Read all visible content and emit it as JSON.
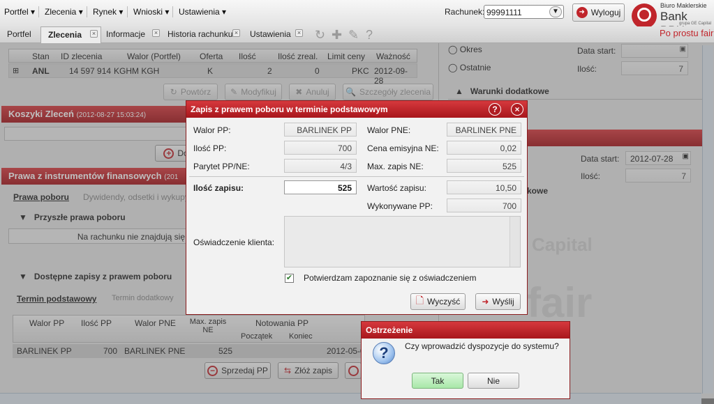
{
  "menu": {
    "items": [
      "Portfel",
      "Zlecenia",
      "Rynek",
      "Wnioski",
      "Ustawienia"
    ]
  },
  "account": {
    "label": "Rachunek:",
    "value": "99991111",
    "logout": "Wyloguj"
  },
  "brand": {
    "line1": "Biuro Maklerskie",
    "line2": "Bank BPH",
    "line3": "grupa GE Capital",
    "slogan": "Po prostu fair"
  },
  "tabs": [
    {
      "label": "Portfel"
    },
    {
      "label": "Zlecenia"
    },
    {
      "label": "Informacje"
    },
    {
      "label": "Historia rachunku"
    },
    {
      "label": "Ustawienia"
    }
  ],
  "orders": {
    "columns": [
      "Stan",
      "ID zlecenia",
      "Walor (Portfel)",
      "Oferta",
      "Ilość",
      "Ilość zreal.",
      "Limit ceny",
      "Ważność"
    ],
    "row": {
      "expand": "⊞",
      "stan": "ANL",
      "id": "14 597 914",
      "walor": "KGHM KGH",
      "oferta": "K",
      "ilosc": "2",
      "zreal": "0",
      "limit": "PKC",
      "waznosc": "2012-09-28"
    },
    "buttons": {
      "repeat": "Powtórz",
      "modify": "Modyfikuj",
      "cancel": "Anuluj",
      "details": "Szczegóły zlecenia"
    }
  },
  "right_panel": {
    "radio1": "Okres",
    "radio2": "Ostatnie",
    "date_start_label": "Data start:",
    "qty_label": "Ilość:",
    "qty_value": "7",
    "conditions": "Warunki dodatkowe",
    "date_start2_label": "Data start:",
    "date_start2_value": "2012-07-28",
    "qty2_label": "Ilość:",
    "qty2_value": "7",
    "conditions2": "kowe"
  },
  "baskets": {
    "title": "Koszyki Zleceń",
    "timestamp": "(2012-08-27 15:03:24)",
    "add_label": "Do"
  },
  "rights": {
    "title": "Prawa z instrumentów finansowych",
    "title_suffix": "(201",
    "tab_active": "Prawa poboru",
    "tab_other": "Dywidendy, odsetki i wykupy c",
    "section1": "Przyszłe prawa poboru",
    "empty_msg": "Na rachunku nie znajdują się",
    "section2": "Dostępne zapisy z prawem poboru",
    "subtab_active": "Termin podstawowy",
    "subtab_other": "Termin dodatkowy",
    "columns": {
      "walor_pp": "Walor PP",
      "ilosc_pp": "Ilość PP",
      "walor_pne": "Walor PNE",
      "max_zapis": "Max. zapis NE",
      "notowania": "Notowania PP",
      "poczatek": "Początek",
      "koniec": "Koniec",
      "zapisy": "Zapisy",
      "poczatek2": "Początek"
    },
    "row": {
      "walor_pp": "BARLINEK PP",
      "ilosc_pp": "700",
      "walor_pne": "BARLINEK PNE",
      "max_zapis": "525",
      "date": "2012-05-0"
    },
    "sell_button": "Sprzedaj PP",
    "submit_button": "Złóż zapis"
  },
  "dialog": {
    "title": "Zapis z prawem poboru w terminie podstawowym",
    "walor_pp_label": "Walor PP:",
    "walor_pp": "BARLINEK PP",
    "walor_pne_label": "Walor PNE:",
    "walor_pne": "BARLINEK PNE",
    "ilosc_pp_label": "Ilość PP:",
    "ilosc_pp": "700",
    "cena_label": "Cena emisyjna NE:",
    "cena": "0,02",
    "parytet_label": "Parytet PP/NE:",
    "parytet": "4/3",
    "max_zapis_label": "Max. zapis NE:",
    "max_zapis": "525",
    "ilosc_zapisu_label": "Ilość zapisu:",
    "ilosc_zapisu": "525",
    "wartosc_label": "Wartość zapisu:",
    "wartosc": "10,50",
    "wykonywane_label": "Wykonywane PP:",
    "wykonywane": "700",
    "oswiadczenie_label": "Oświadczenie klienta:",
    "checkbox_label": "Potwierdzam zapoznanie się z oświadczeniem",
    "clear_button": "Wyczyść",
    "send_button": "Wyślij"
  },
  "warning": {
    "title": "Ostrzeżenie",
    "message": "Czy wprowadzić dyspozycje do systemu?",
    "yes": "Tak",
    "no": "Nie"
  },
  "background_text": {
    "capital": "Capital",
    "fair": "fair"
  }
}
